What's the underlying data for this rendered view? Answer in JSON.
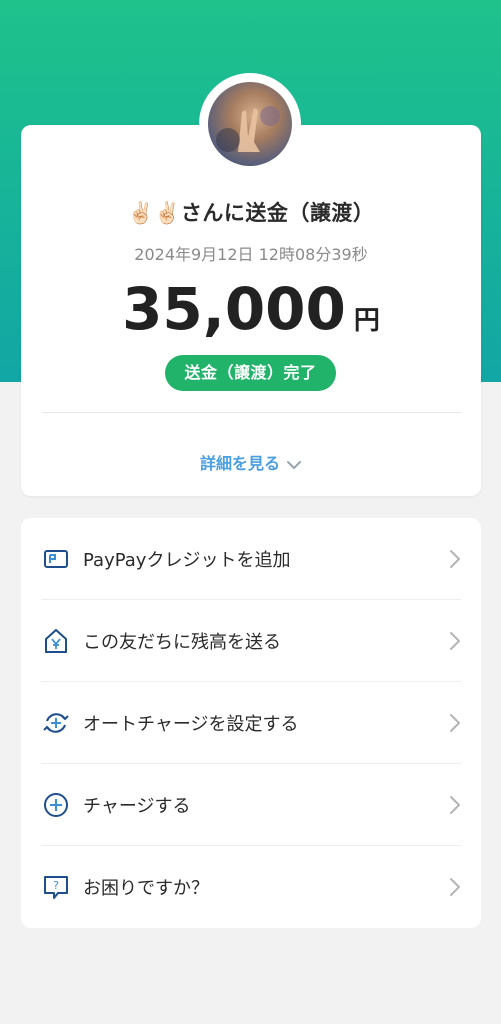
{
  "header": {
    "accent_color": "#1ec28a",
    "accent_color_end": "#12a6a4"
  },
  "transfer": {
    "recipient": "✌🏻✌🏻さんに送金（譲渡）",
    "datetime": "2024年9月12日 12時08分39秒",
    "amount": "35,000",
    "currency": "円",
    "status": "送金（譲渡）完了",
    "status_color": "#21b36a",
    "details_link": "詳細を見る"
  },
  "menu": {
    "items": [
      {
        "label": "PayPayクレジットを追加",
        "icon": "credit-card-icon"
      },
      {
        "label": "この友だちに残高を送る",
        "icon": "yen-send-icon"
      },
      {
        "label": "オートチャージを設定する",
        "icon": "auto-charge-icon"
      },
      {
        "label": "チャージする",
        "icon": "plus-circle-icon"
      },
      {
        "label": "お困りですか？",
        "icon": "help-chat-icon"
      }
    ]
  }
}
